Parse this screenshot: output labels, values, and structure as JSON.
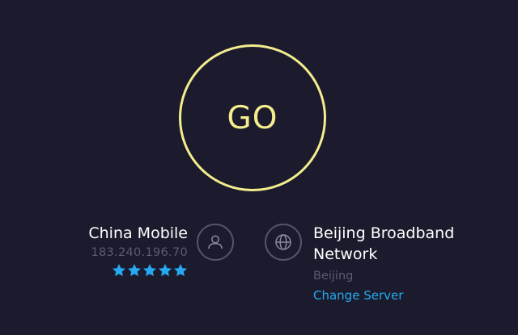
{
  "go_button": {
    "label": "GO"
  },
  "client": {
    "isp_name": "China Mobile",
    "ip_address": "183.240.196.70",
    "rating_stars": 5,
    "rating_max": 5,
    "icon": "user-icon"
  },
  "server": {
    "name": "Beijing Broadband Network",
    "city": "Beijing",
    "change_server_label": "Change Server",
    "icon": "globe-icon"
  },
  "colors": {
    "background": "#1b1b2d",
    "accent_yellow": "#f4ed8e",
    "link_blue": "#26a9f0",
    "star_blue": "#26a9f0",
    "muted_text": "#5c5c70",
    "icon_ring": "#555567"
  }
}
